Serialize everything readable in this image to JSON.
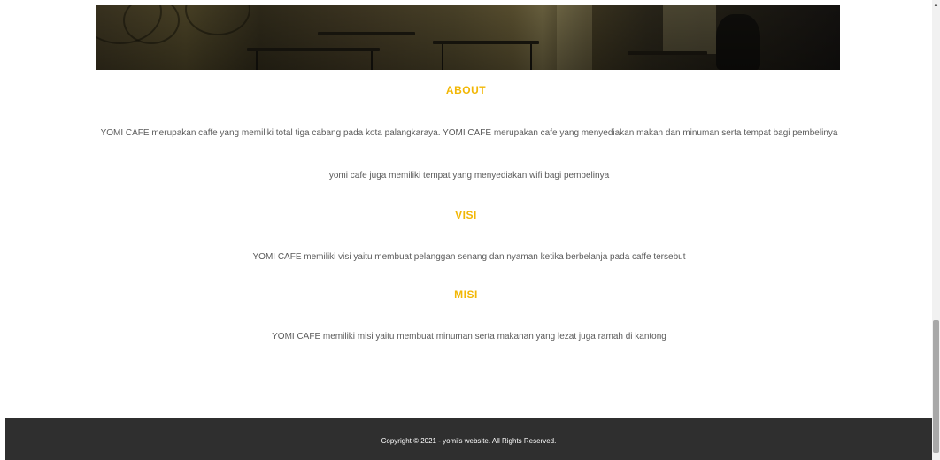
{
  "about": {
    "heading": "ABOUT",
    "paragraph1": "YOMI CAFE merupakan caffe yang memiliki total tiga cabang pada kota palangkaraya. YOMI CAFE merupakan cafe yang menyediakan makan dan minuman serta tempat bagi pembelinya",
    "paragraph2": "yomi cafe juga memiliki tempat yang menyediakan wifi bagi pembelinya"
  },
  "visi": {
    "heading": "VISI",
    "paragraph": "YOMI CAFE memiliki visi yaitu membuat pelanggan senang dan nyaman ketika berbelanja pada caffe tersebut"
  },
  "misi": {
    "heading": "MISI",
    "paragraph": "YOMI CAFE memiliki misi yaitu membuat minuman serta makanan yang lezat juga ramah di kantong"
  },
  "footer": {
    "copyright": "Copyright © 2021 - yomi's website. All Rights Reserved."
  },
  "colors": {
    "accent": "#f2b705",
    "body_text": "#5a5a5a",
    "footer_bg": "#2f2f2f"
  },
  "icons": {
    "scroll_up": "triangle-up-icon"
  }
}
